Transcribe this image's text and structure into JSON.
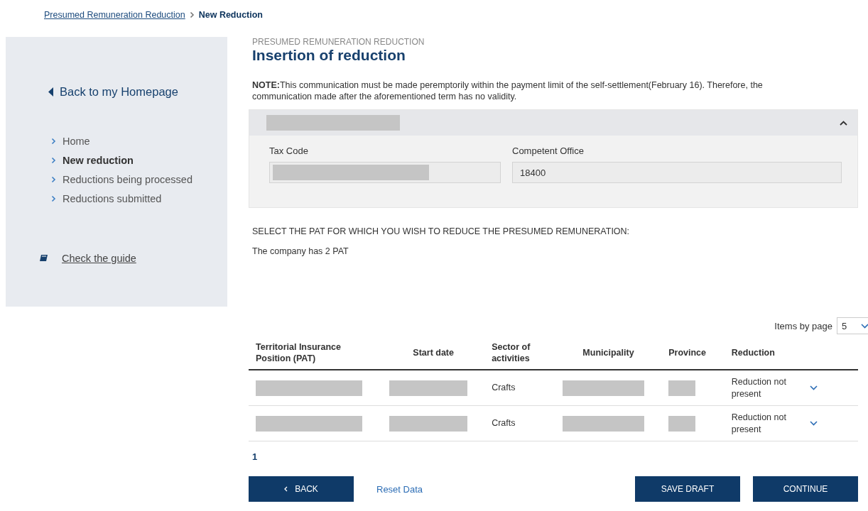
{
  "breadcrumb": [
    {
      "label": "Presumed Remuneration Reduction",
      "kind": "link"
    },
    {
      "label": "New Reduction",
      "kind": "current"
    }
  ],
  "sidebar": {
    "back_link": "Back to my Homepage",
    "items": [
      {
        "label": "Home",
        "selected": false
      },
      {
        "label": "New reduction",
        "selected": true
      },
      {
        "label": "Reductions being processed",
        "selected": false
      },
      {
        "label": "Reductions submitted",
        "selected": false
      }
    ],
    "guide_link": "Check the guide"
  },
  "page": {
    "overline": "PRESUMED REMUNERATION REDUCTION",
    "title": "Insertion of reduction",
    "note": "**NOTE:**This communication must be made peremptorily within the payment limit of the self-settlement(February 16). Therefore, the communication made after the aforementioned term has no validity."
  },
  "company_panel": {
    "expanded": true,
    "fields": [
      {
        "label": "Tax Code",
        "value_redacted": true
      },
      {
        "label": "Competent Office",
        "value": "18400",
        "value_redacted": false
      }
    ]
  },
  "select_prompt": "SELECT THE PAT FOR WHICH YOU WISH TO REDUCE THE PRESUMED REMUNERATION:",
  "pat_count": "The company has 2 PAT",
  "pager": {
    "label": "Items by page",
    "value": "5"
  },
  "table": {
    "columns": [
      "Territorial Insurance Position (PAT)",
      "Start date",
      "Sector of activities",
      "Municipality",
      "Province",
      "Reduction"
    ],
    "rows": [
      {
        "sector": "Crafts",
        "reduction": "Reduction not present",
        "expanded": false
      },
      {
        "sector": "Crafts",
        "reduction": "Reduction not present",
        "expanded": false
      }
    ]
  },
  "pages": [
    {
      "label": "1",
      "selected": true
    }
  ],
  "buttons": {
    "back": "BACK",
    "reset": "Reset Data",
    "save": "SAVE DRAFT",
    "continue": "CONTINUE"
  }
}
